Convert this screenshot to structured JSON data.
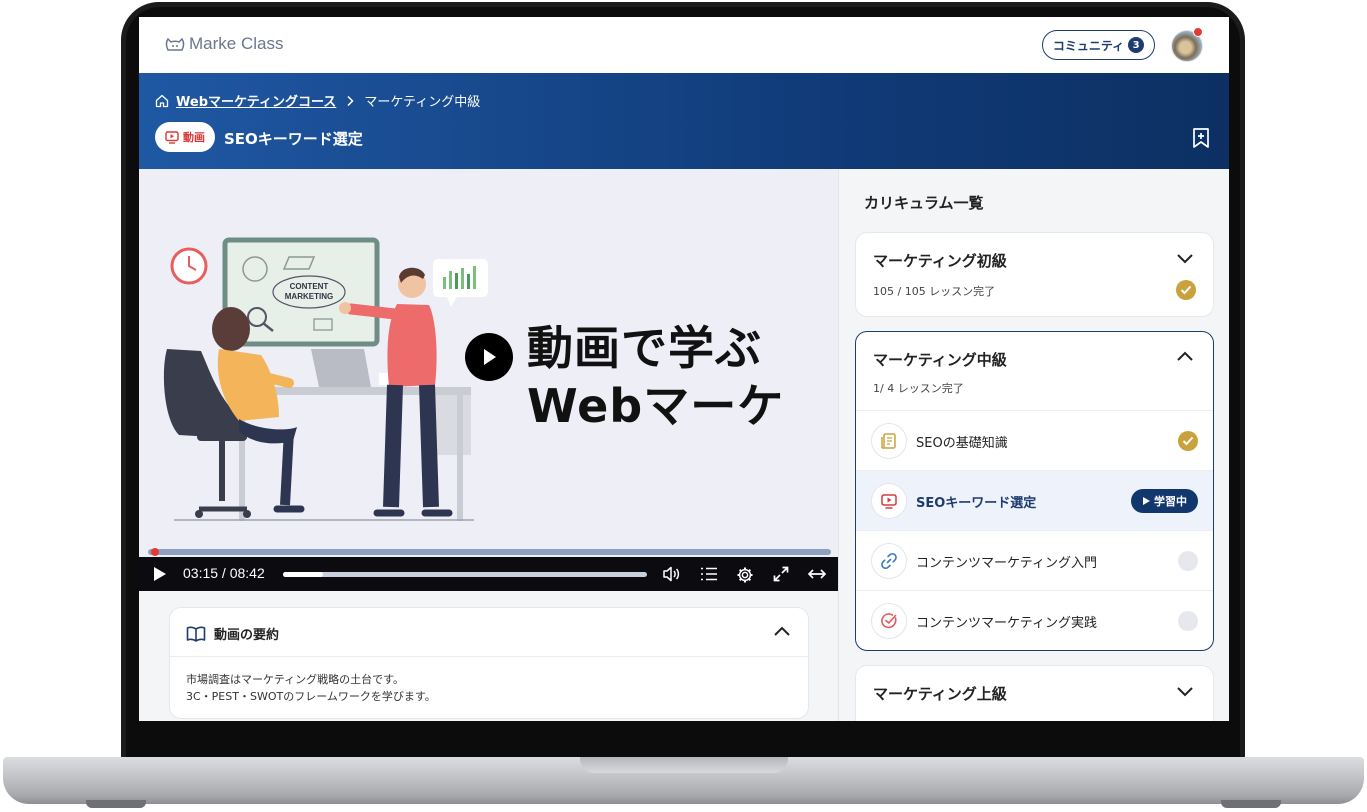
{
  "app": {
    "logo_text": "Marke Class"
  },
  "topbar": {
    "community_label": "コミュニティ",
    "community_count": "3"
  },
  "breadcrumb": {
    "course": "Webマーケティングコース",
    "separator": ">",
    "current": "マーケティング中級"
  },
  "lesson": {
    "type_label": "動画",
    "title": "SEOキーワード選定"
  },
  "video": {
    "caption_line1": "動画で学ぶ",
    "caption_line2": "Webマーケ",
    "illustration": {
      "board_text1": "CONTENT",
      "board_text2": "MARKETING"
    },
    "time": "03:15 / 08:42",
    "progress_fraction": 0.006,
    "volume_fraction": 0.11
  },
  "summary": {
    "title": "動画の要約",
    "line1": "市場調査はマーケティング戦略の土台です。",
    "line2": "3C・PEST・SWOTのフレームワークを学びます。"
  },
  "curriculum": {
    "title": "カリキュラム一覧",
    "sections": [
      {
        "title": "マーケティング初級",
        "progress": "105 / 105  レッスン完了",
        "completed": true
      },
      {
        "title": "マーケティング中級",
        "progress": "1/ 4  レッスン完了",
        "expanded": true,
        "lessons": [
          {
            "label": "SEOの基礎知識",
            "icon": "document-icon",
            "status": "done"
          },
          {
            "label": "SEOキーワード選定",
            "icon": "video-icon",
            "status": "current",
            "badge": "学習中"
          },
          {
            "label": "コンテンツマーケティング入門",
            "icon": "link-icon",
            "status": "todo"
          },
          {
            "label": "コンテンツマーケティング実践",
            "icon": "check-circle-icon",
            "status": "todo"
          }
        ]
      },
      {
        "title": "マーケティング上級"
      }
    ]
  },
  "colors": {
    "navy": "#1f3c6e",
    "gold": "#c9a23c",
    "red": "#e53935"
  }
}
